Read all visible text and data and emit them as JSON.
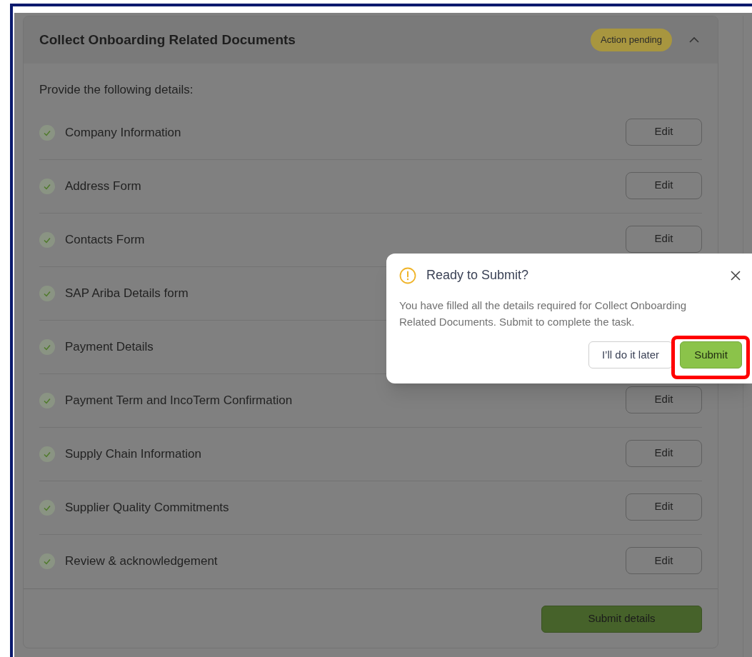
{
  "card": {
    "title": "Collect Onboarding Related Documents",
    "badge": "Action pending",
    "expanded": true,
    "intro": "Provide the following details:",
    "items": [
      {
        "label": "Company Information",
        "done": true,
        "edit": "Edit"
      },
      {
        "label": "Address Form",
        "done": true,
        "edit": "Edit"
      },
      {
        "label": "Contacts Form",
        "done": true,
        "edit": "Edit"
      },
      {
        "label": "SAP Ariba Details form",
        "done": true
      },
      {
        "label": "Payment Details",
        "done": true
      },
      {
        "label": "Payment Term and IncoTerm Confirmation",
        "done": true,
        "edit": "Edit"
      },
      {
        "label": "Supply Chain Information",
        "done": true,
        "edit": "Edit"
      },
      {
        "label": "Supplier Quality Commitments",
        "done": true,
        "edit": "Edit"
      },
      {
        "label": "Review & acknowledgement",
        "done": true,
        "edit": "Edit"
      }
    ],
    "submit": "Submit details"
  },
  "dialog": {
    "title": "Ready to Submit?",
    "message": "You have filled all the details required for Collect Onboarding Related Documents. Submit to complete the task.",
    "secondary": "I’ll do it later",
    "primary": "Submit",
    "primary_highlighted": true
  }
}
